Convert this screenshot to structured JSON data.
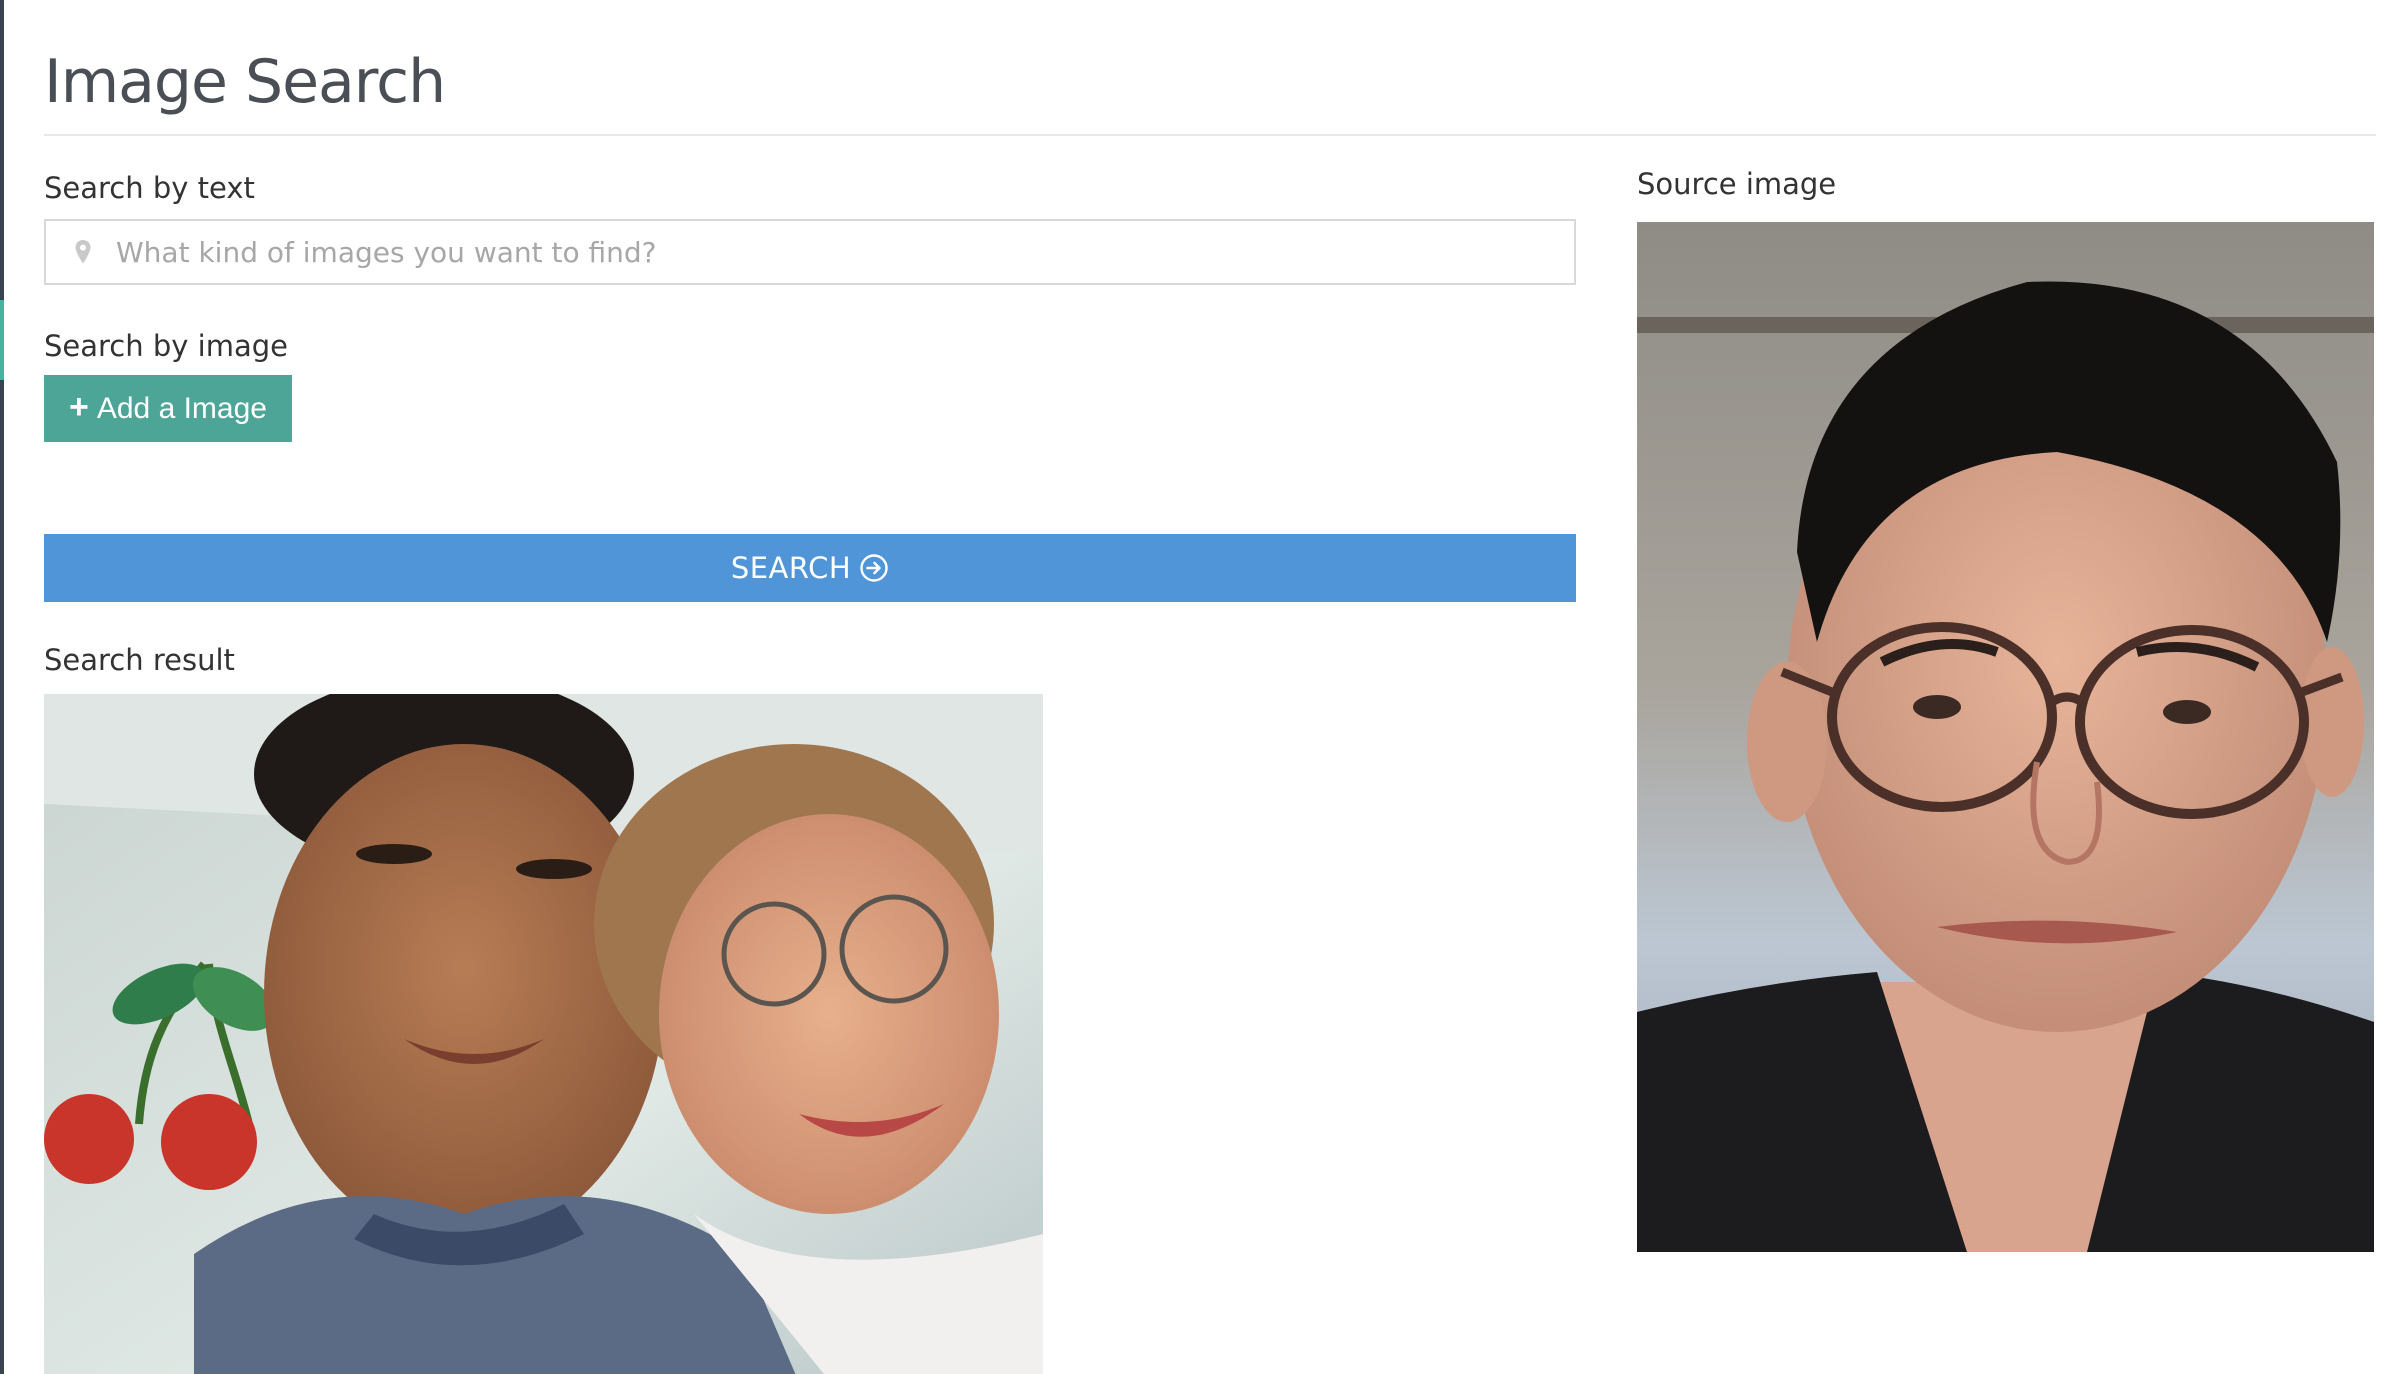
{
  "page": {
    "title": "Image Search"
  },
  "search_text": {
    "label": "Search by text",
    "placeholder": "What kind of images you want to find?",
    "value": "",
    "icon": "map-marker-icon"
  },
  "search_image": {
    "label": "Search by image",
    "add_button_label": "Add a Image",
    "add_icon": "plus-icon"
  },
  "search_button": {
    "label": "SEARCH",
    "icon": "circle-arrow-right-icon"
  },
  "result": {
    "label": "Search result",
    "image_alt": "Photo of a boy and a girl with glasses smiling, cherry decorations on wall"
  },
  "source": {
    "label": "Source image",
    "image_alt": "Portrait photo of a young man wearing glasses"
  },
  "colors": {
    "accent_teal": "#4da598",
    "search_blue": "#4f95d8",
    "sidebar_dark": "#3a4350"
  }
}
